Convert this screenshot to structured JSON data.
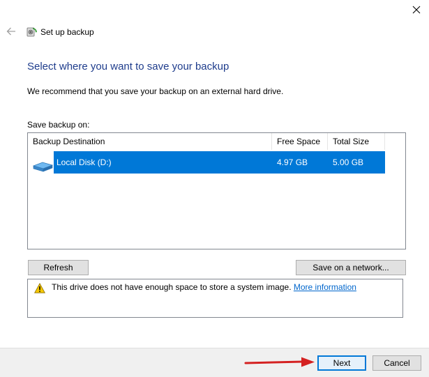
{
  "window": {
    "title": "Set up backup"
  },
  "icons": {
    "close": "close-icon",
    "back": "back-arrow-icon",
    "app": "backup-icon",
    "drive": "hard-drive-icon",
    "warning": "warning-icon"
  },
  "colors": {
    "heading": "#1e3c8c",
    "selection": "#0078d7",
    "link": "#0066cc",
    "footer": "#f0f0f0",
    "annotation_arrow": "#d42121"
  },
  "main": {
    "heading": "Select where you want to save your backup",
    "intro": "We recommend that you save your backup on an external hard drive.",
    "save_label": "Save backup on:"
  },
  "table": {
    "columns": [
      "Backup Destination",
      "Free Space",
      "Total Size"
    ],
    "rows": [
      {
        "destination": "Local Disk (D:)",
        "free_space": "4.97 GB",
        "total_size": "5.00 GB",
        "selected": true
      }
    ]
  },
  "buttons": {
    "refresh": "Refresh",
    "save_network": "Save on a network...",
    "next": "Next",
    "cancel": "Cancel"
  },
  "warning": {
    "text": "This drive does not have enough space to store a system image.",
    "link": "More information"
  }
}
